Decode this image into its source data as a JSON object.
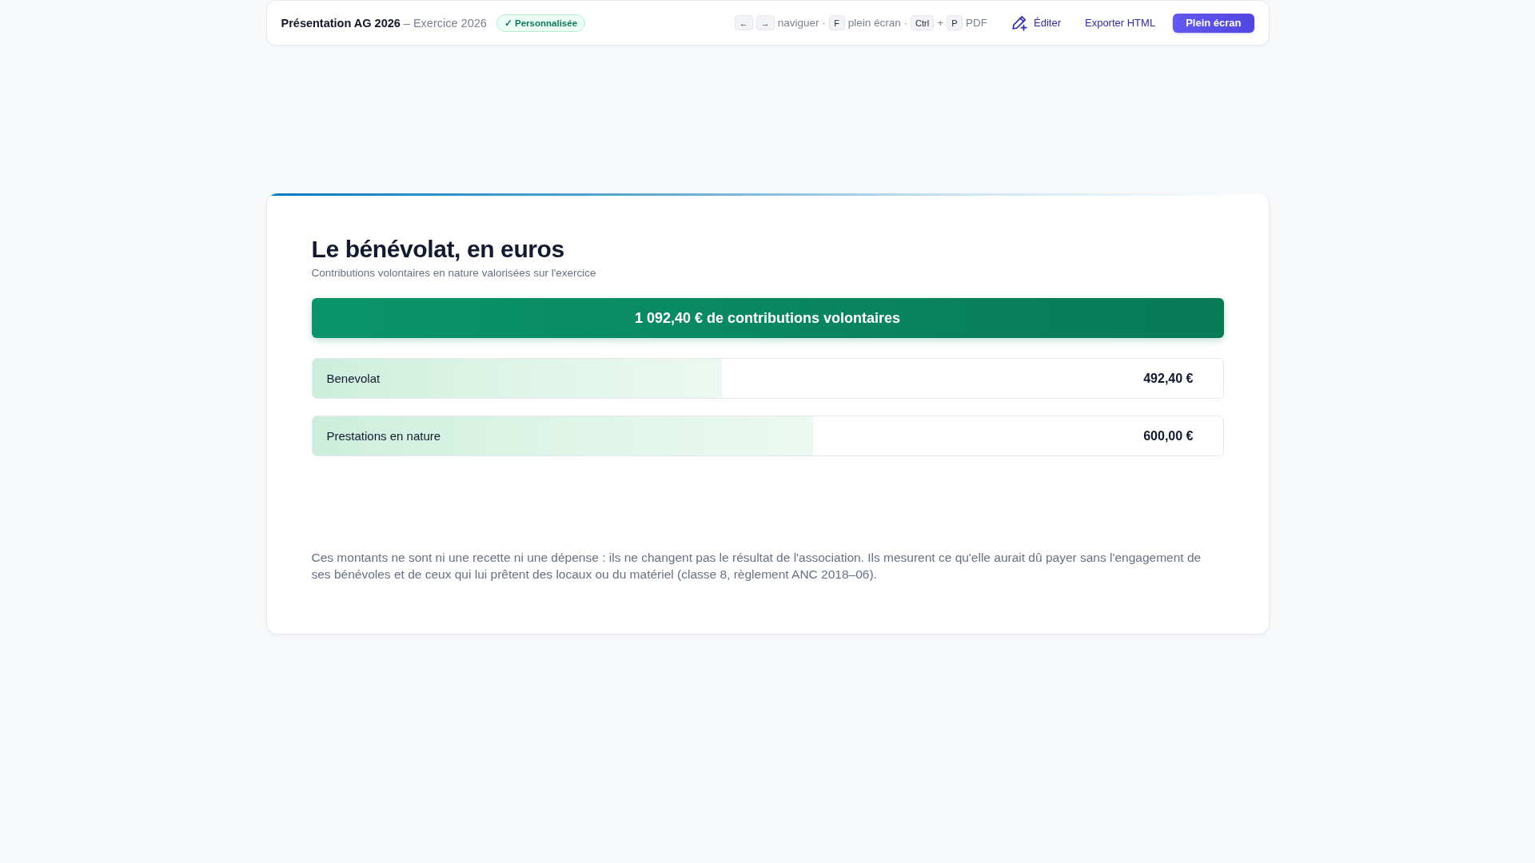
{
  "topbar": {
    "title": "Présentation AG 2026",
    "subtitle": "– Exercice 2026",
    "badge": "✓ Personnalisée",
    "shortcuts": [
      {
        "kind": "key",
        "text": "←"
      },
      {
        "kind": "key",
        "text": "→"
      },
      {
        "kind": "text",
        "text": "naviguer ·"
      },
      {
        "kind": "key",
        "text": "F"
      },
      {
        "kind": "text",
        "text": "plein écran ·"
      },
      {
        "kind": "key",
        "text": "Ctrl"
      },
      {
        "kind": "text",
        "text": "+"
      },
      {
        "kind": "key",
        "text": "P"
      },
      {
        "kind": "text",
        "text": "PDF"
      }
    ],
    "actions": [
      {
        "kind": "edit",
        "label": "Éditer"
      },
      {
        "kind": "link",
        "label": "Exporter HTML"
      },
      {
        "kind": "primary",
        "label": "Plein écran"
      }
    ]
  },
  "slide": {
    "title": "Le bénévolat, en euros",
    "subtitle": "Contributions volontaires en nature valorisées sur l'exercice",
    "total": "1 092,40 € de contributions volontaires",
    "rows": [
      {
        "label": "Benevolat",
        "value": "492,40 €",
        "level": 0.45
      },
      {
        "label": "Prestations en nature",
        "value": "600,00 €",
        "level": 0.55
      }
    ],
    "note": "Ces montants ne sont ni une recette ni une dépense : ils ne changent pas le résultat de l'association. Ils mesurent ce qu'elle aurait dû payer sans l'engagement de ses bénévoles et de ceux qui lui prêtent des locaux ou du matériel (classe 8, règlement ANC 2018–06)."
  }
}
